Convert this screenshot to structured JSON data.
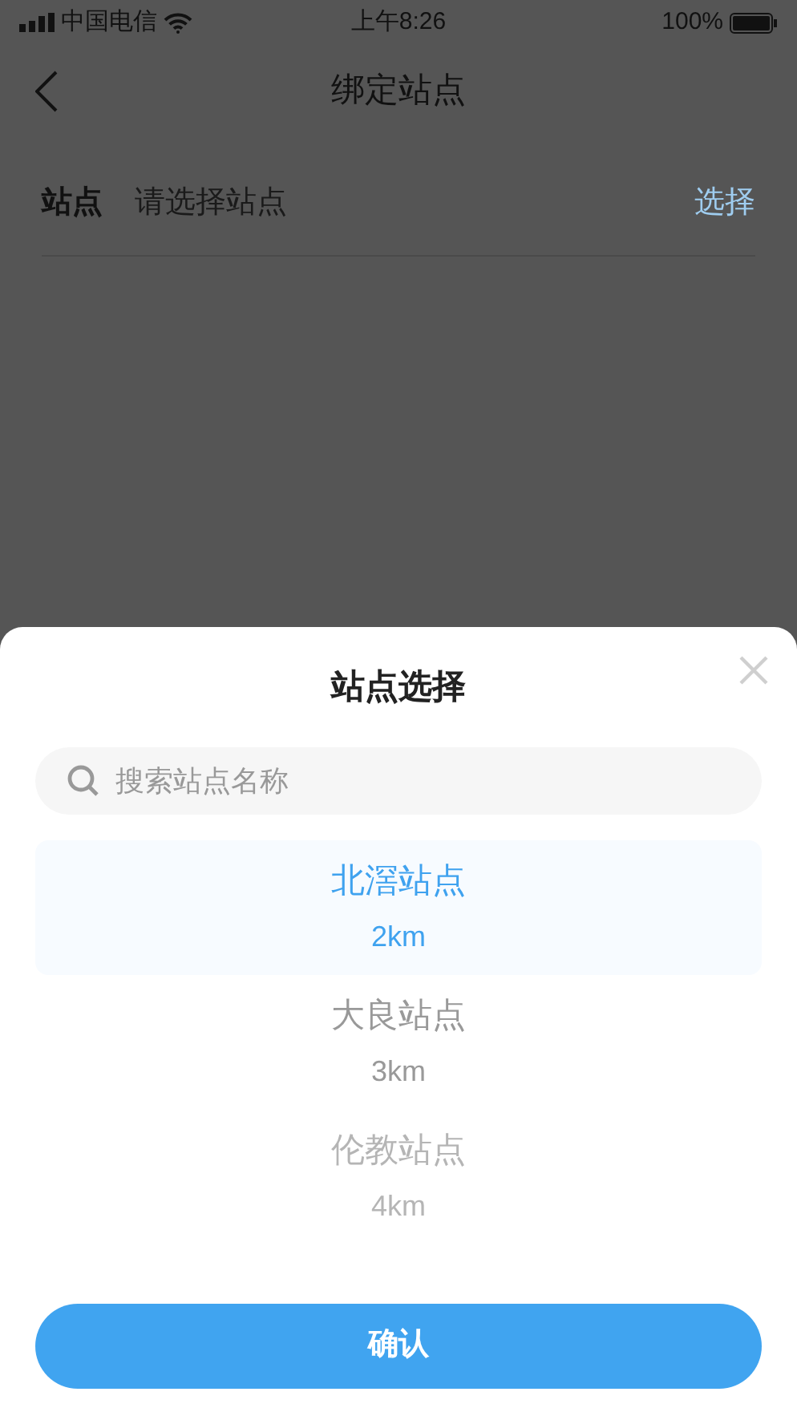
{
  "status_bar": {
    "carrier": "中国电信",
    "time": "上午8:26",
    "battery": "100%"
  },
  "nav": {
    "title": "绑定站点"
  },
  "form": {
    "label": "站点",
    "placeholder": "请选择站点",
    "action": "选择"
  },
  "sheet": {
    "title": "站点选择",
    "search": {
      "placeholder": "搜索站点名称"
    },
    "stations": [
      {
        "name": "北滘站点",
        "distance": "2km",
        "selected": true
      },
      {
        "name": "大良站点",
        "distance": "3km",
        "selected": false
      },
      {
        "name": "伦教站点",
        "distance": "4km",
        "selected": false
      }
    ],
    "confirm": "确认"
  }
}
